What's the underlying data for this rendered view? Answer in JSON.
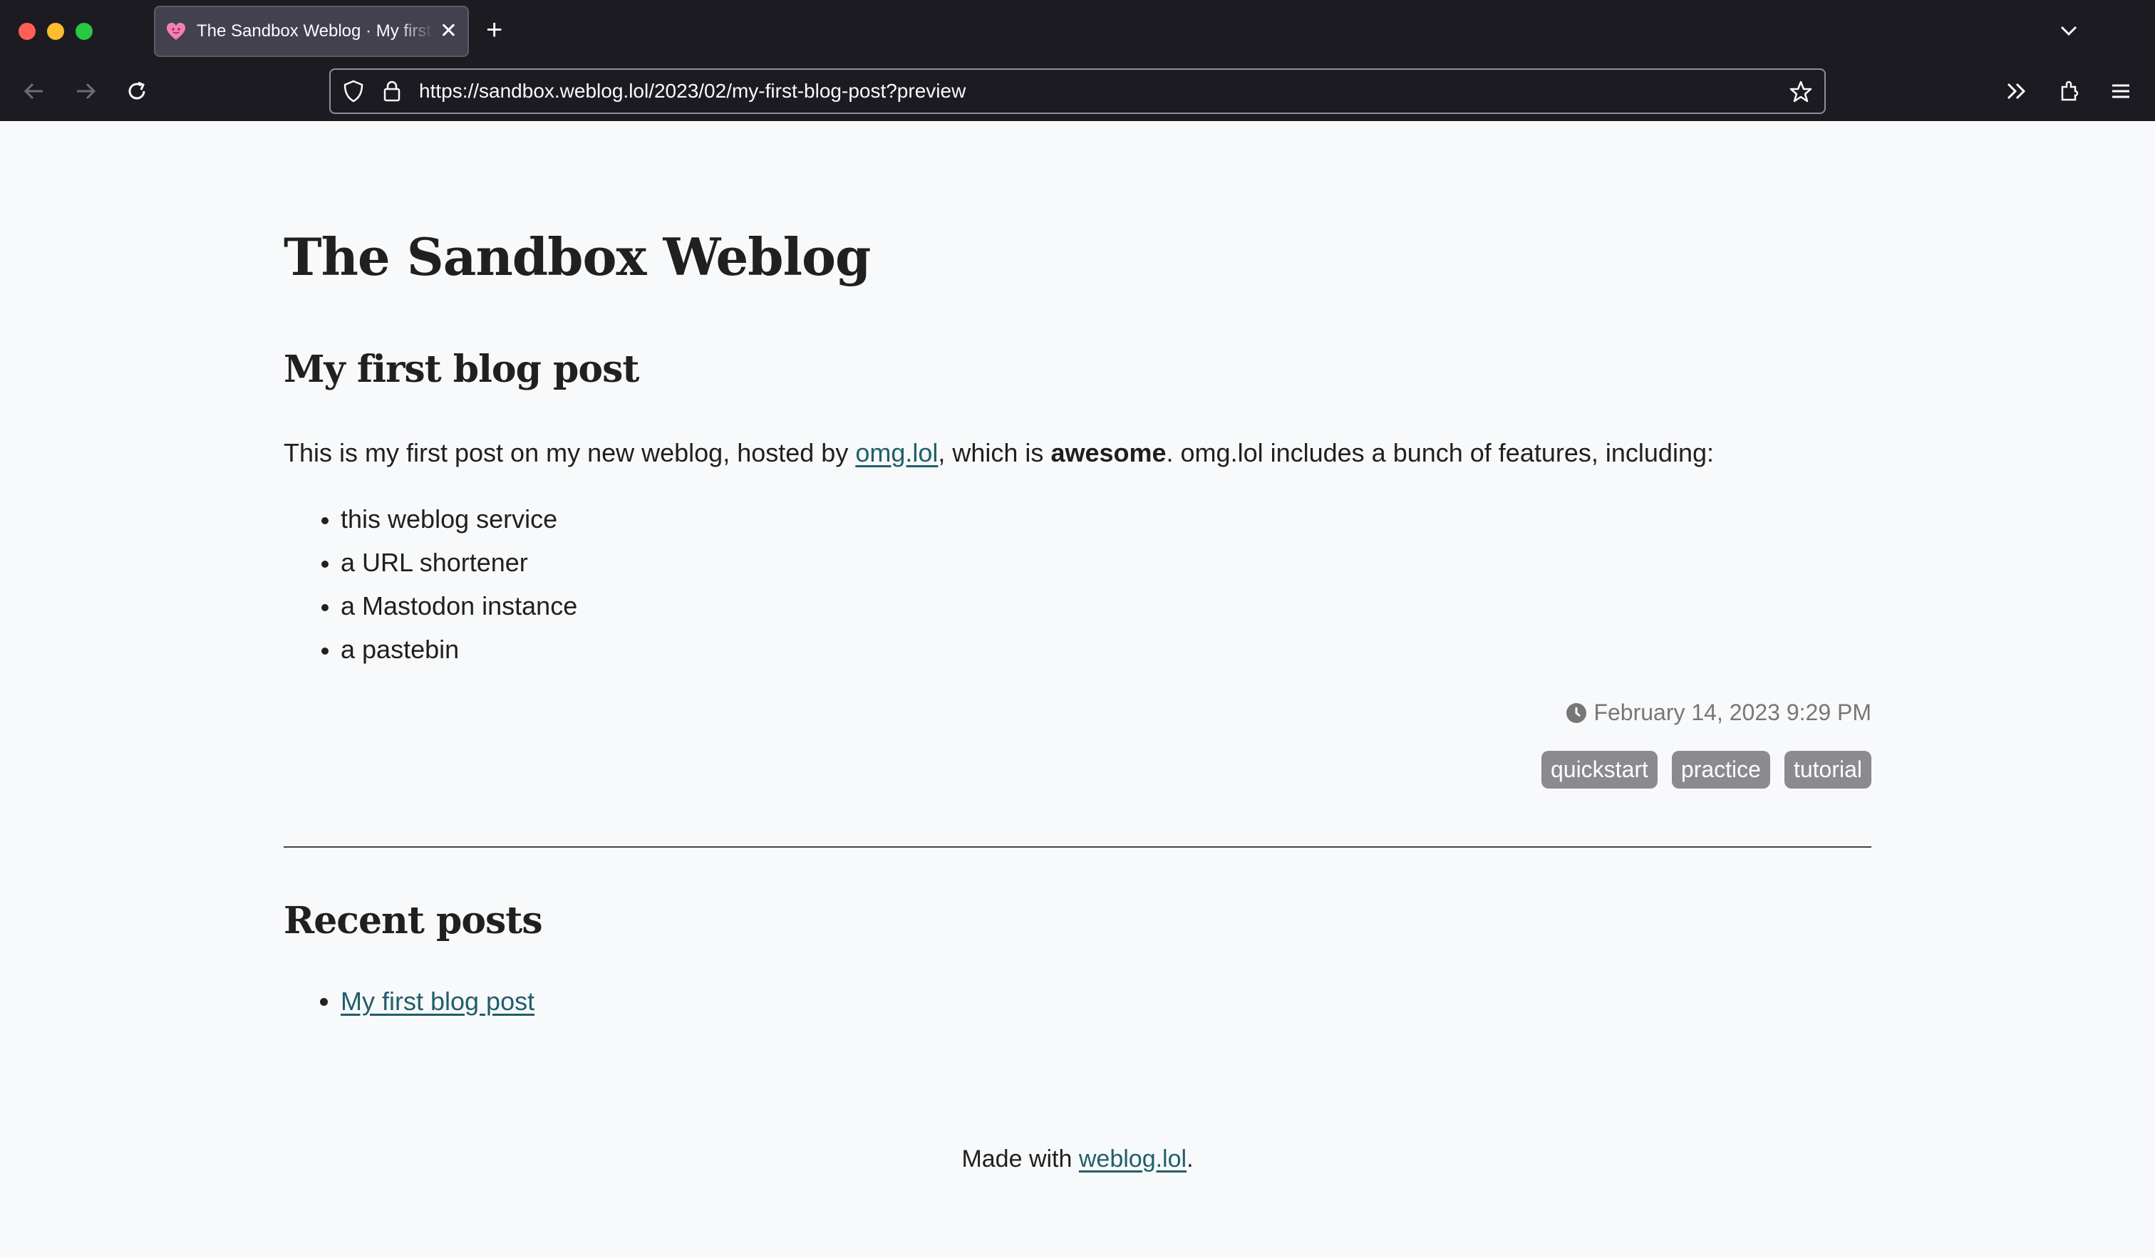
{
  "browser": {
    "tab_title": "The Sandbox Weblog · My first blog post",
    "url": "https://sandbox.weblog.lol/2023/02/my-first-blog-post?preview"
  },
  "page": {
    "site_title": "The Sandbox Weblog",
    "post_title": "My first blog post",
    "intro_prefix": "This is my first post on my new weblog, hosted by ",
    "intro_link": "omg.lol",
    "intro_middle": ", which is ",
    "intro_bold": "awesome",
    "intro_suffix": ". omg.lol includes a bunch of features, including:",
    "features": [
      "this weblog service",
      "a URL shortener",
      "a Mastodon instance",
      "a pastebin"
    ],
    "date": "February 14, 2023 9:29 PM",
    "tags": [
      "quickstart",
      "practice",
      "tutorial"
    ],
    "recent_title": "Recent posts",
    "recent_posts": [
      "My first blog post"
    ],
    "footer_prefix": "Made with ",
    "footer_link": "weblog.lol",
    "footer_suffix": "."
  },
  "colors": {
    "chrome_bg": "#1c1b22",
    "page_bg": "#f8f9fa",
    "link": "#1f5f6b",
    "tag_bg": "#8a8a8f"
  }
}
